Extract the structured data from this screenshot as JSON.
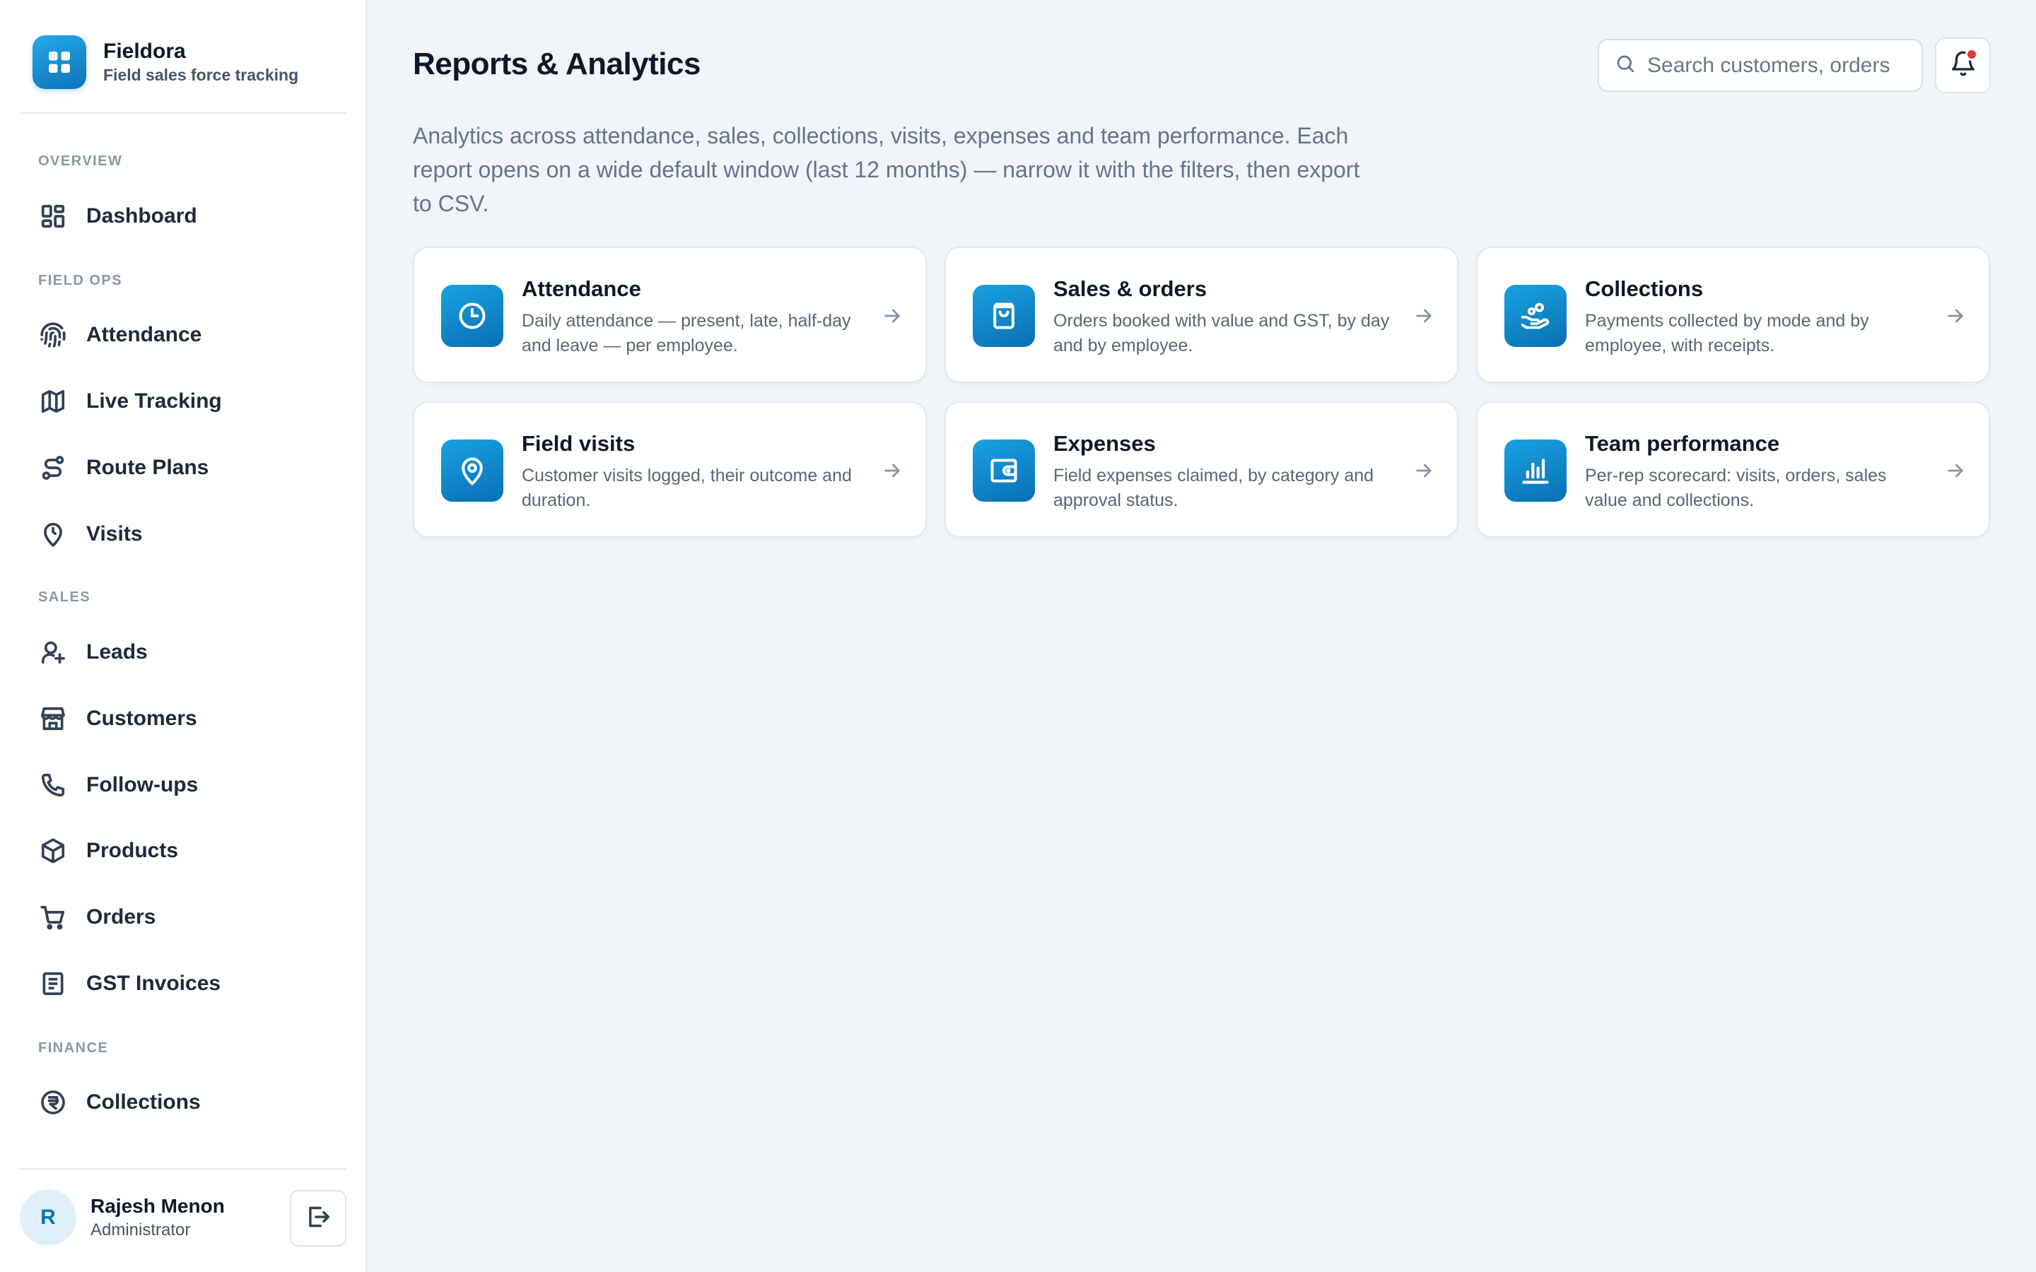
{
  "brand": {
    "name": "Fieldora",
    "subtitle": "Field sales force tracking",
    "logo_icon": "grid-icon"
  },
  "sidebar": {
    "sections": {
      "overview": "OVERVIEW",
      "field_ops": "FIELD OPS",
      "sales": "SALES",
      "finance": "FINANCE"
    },
    "items": [
      {
        "label": "Dashboard",
        "icon": "dashboard-icon"
      },
      {
        "label": "Attendance",
        "icon": "fingerprint-icon"
      },
      {
        "label": "Live Tracking",
        "icon": "map-icon"
      },
      {
        "label": "Route Plans",
        "icon": "route-icon"
      },
      {
        "label": "Visits",
        "icon": "map-pin-clock-icon"
      },
      {
        "label": "Leads",
        "icon": "user-plus-icon"
      },
      {
        "label": "Customers",
        "icon": "store-icon"
      },
      {
        "label": "Follow-ups",
        "icon": "phone-icon"
      },
      {
        "label": "Products",
        "icon": "box-icon"
      },
      {
        "label": "Orders",
        "icon": "cart-icon"
      },
      {
        "label": "GST Invoices",
        "icon": "invoice-icon"
      },
      {
        "label": "Collections",
        "icon": "rupee-circle-icon"
      }
    ]
  },
  "user": {
    "initial": "R",
    "name": "Rajesh Menon",
    "role": "Administrator",
    "logout_icon": "logout-icon"
  },
  "header": {
    "title": "Reports & Analytics",
    "search_placeholder": "Search customers, orders",
    "notification_icon": "bell-icon"
  },
  "intro": "Analytics across attendance, sales, collections, visits, expenses and team performance. Each report opens on a wide default window (last 12 months) — narrow it with the filters, then export to CSV.",
  "reports": [
    {
      "title": "Attendance",
      "description": "Daily attendance — present, late, half-day and leave — per employee.",
      "icon": "clock-icon"
    },
    {
      "title": "Sales & orders",
      "description": "Orders booked with value and GST, by day and by employee.",
      "icon": "shopping-bag-icon"
    },
    {
      "title": "Collections",
      "description": "Payments collected by mode and by employee, with receipts.",
      "icon": "hand-coins-icon"
    },
    {
      "title": "Field visits",
      "description": "Customer visits logged, their outcome and duration.",
      "icon": "map-pin-icon"
    },
    {
      "title": "Expenses",
      "description": "Field expenses claimed, by category and approval status.",
      "icon": "wallet-icon"
    },
    {
      "title": "Team performance",
      "description": "Per-rep scorecard: visits, orders, sales value and collections.",
      "icon": "bar-chart-icon"
    }
  ],
  "colors": {
    "accent": "#0b74b8",
    "accent_light": "#26a9e8",
    "background": "#f1f4f9",
    "notification_dot": "#e53935"
  }
}
